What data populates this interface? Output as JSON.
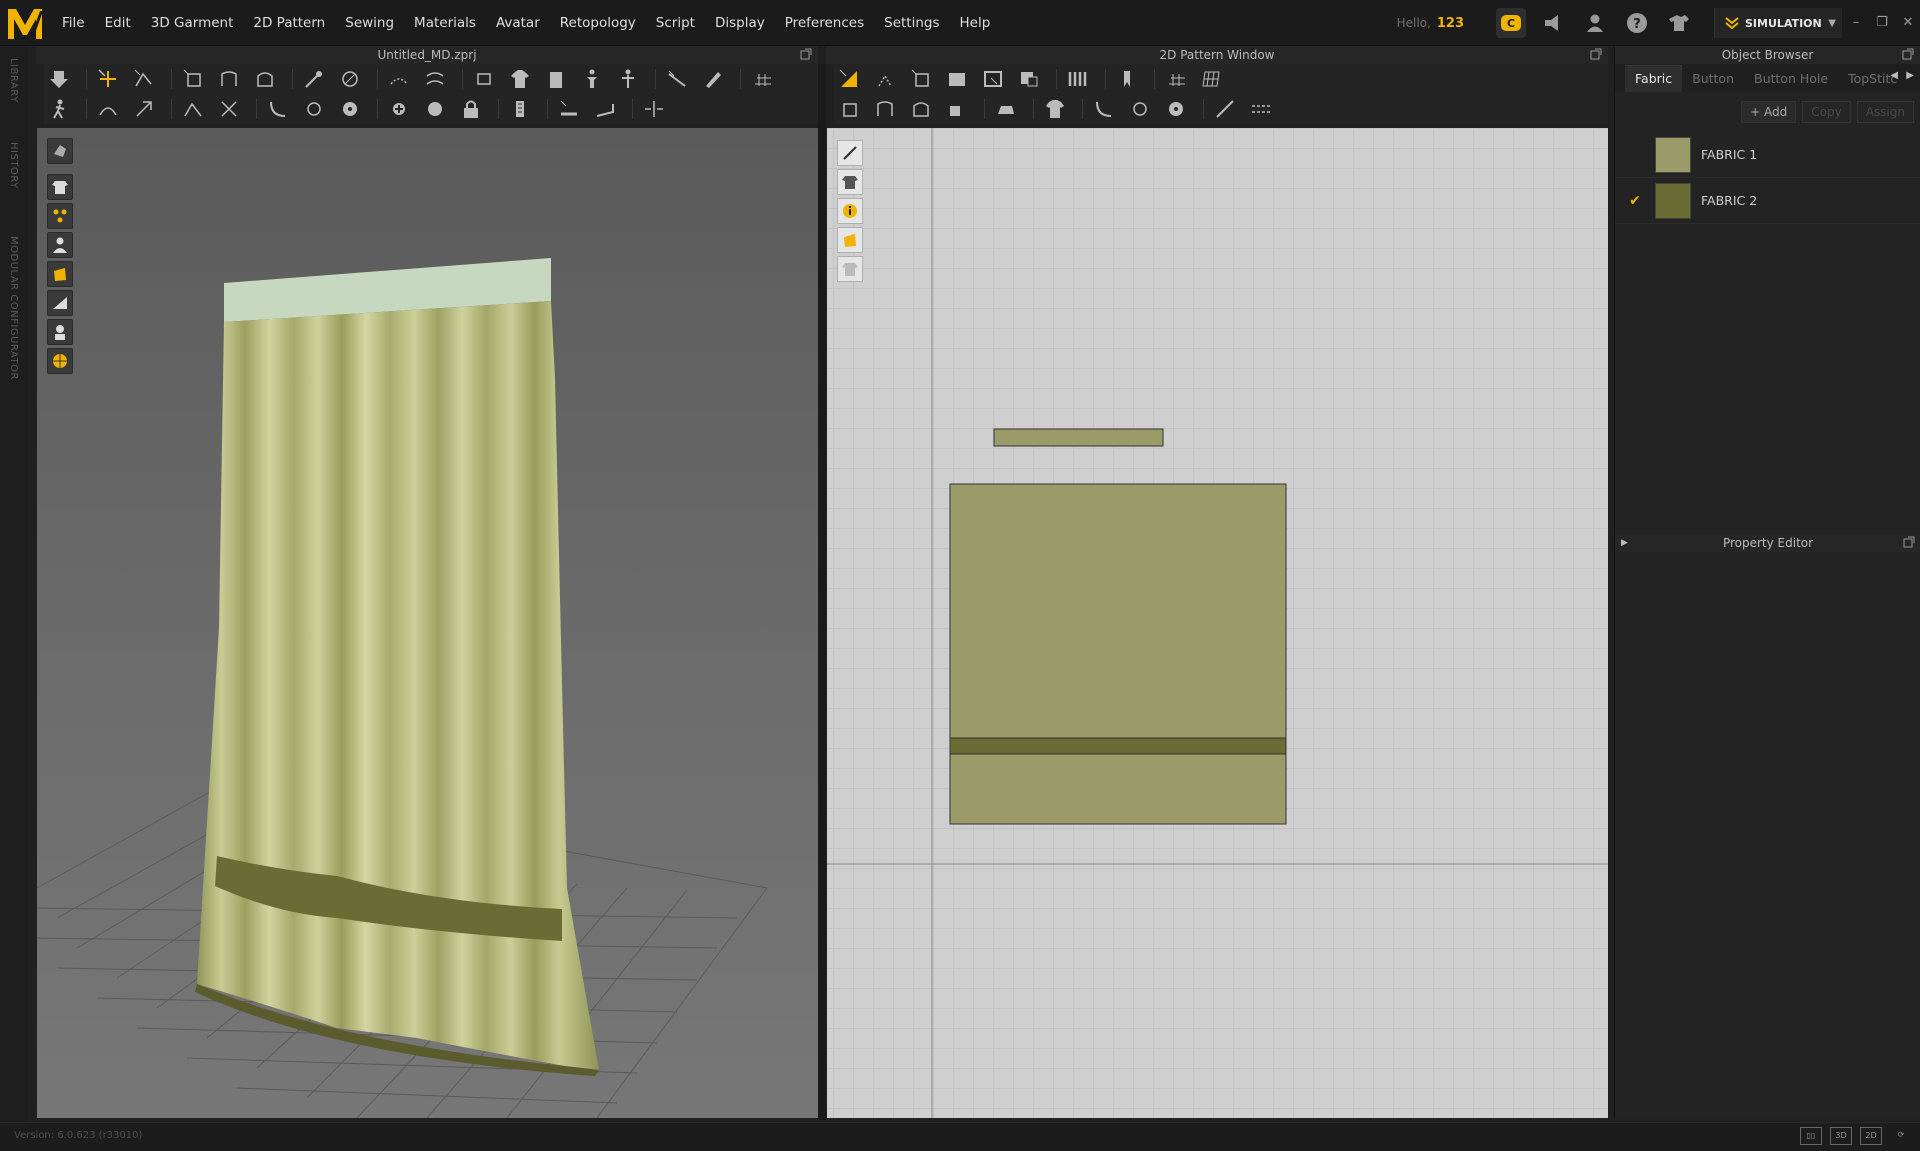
{
  "app": {
    "logo": "md-logo"
  },
  "menu": [
    "File",
    "Edit",
    "3D Garment",
    "2D Pattern",
    "Sewing",
    "Materials",
    "Avatar",
    "Retopology",
    "Script",
    "Display",
    "Preferences",
    "Settings",
    "Help"
  ],
  "user": {
    "hello": "Hello,",
    "id": "123"
  },
  "mode": {
    "label": "SIMULATION"
  },
  "side_tabs": [
    "LIBRARY",
    "HISTORY",
    "MODULAR CONFIGURATOR"
  ],
  "view3d": {
    "title": "Untitled_MD.zprj"
  },
  "view2d": {
    "title": "2D Pattern Window"
  },
  "object_browser": {
    "title": "Object Browser",
    "tabs": [
      {
        "label": "Fabric",
        "active": true
      },
      {
        "label": "Button",
        "active": false
      },
      {
        "label": "Button Hole",
        "active": false
      },
      {
        "label": "TopStitc",
        "active": false
      }
    ],
    "actions": {
      "add": "+ Add",
      "copy": "Copy",
      "assign": "Assign"
    },
    "fabrics": [
      {
        "name": "FABRIC 1",
        "color": "#9a9b68",
        "checked": false
      },
      {
        "name": "FABRIC 2",
        "color": "#6b6b35",
        "checked": true
      }
    ]
  },
  "property_editor": {
    "title": "Property Editor"
  },
  "status": {
    "version": "Version: 6.0.623 (r33010)"
  },
  "colors": {
    "accent": "#f0b400",
    "fabric_light": "#9a9b68",
    "fabric_dark": "#6b6b35",
    "curtain_top": "#c6d9c0"
  }
}
